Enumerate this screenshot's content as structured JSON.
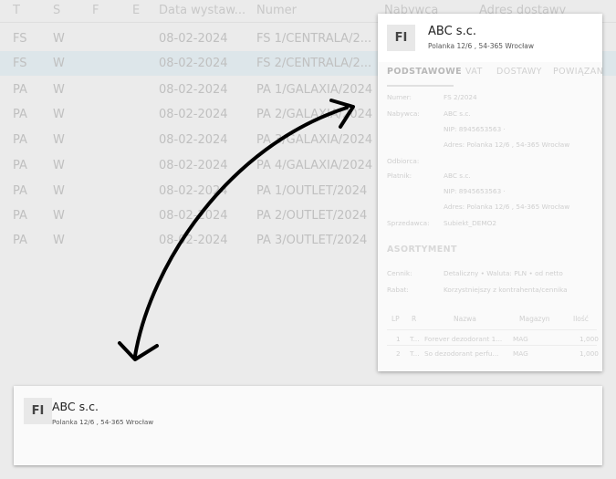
{
  "table": {
    "headers": [
      "T",
      "S",
      "F",
      "E",
      "Data wystaw...",
      "Numer",
      "Nabywca",
      "Adres dostawy"
    ],
    "rows": [
      {
        "t": "FS",
        "s": "W",
        "date": "08-02-2024",
        "num": "FS 1/CENTRALA/2..."
      },
      {
        "t": "FS",
        "s": "W",
        "date": "08-02-2024",
        "num": "FS 2/CENTRALA/2..."
      },
      {
        "t": "PA",
        "s": "W",
        "date": "08-02-2024",
        "num": "PA 1/GALAXIA/2024"
      },
      {
        "t": "PA",
        "s": "W",
        "date": "08-02-2024",
        "num": "PA 2/GALAXIA/2024"
      },
      {
        "t": "PA",
        "s": "W",
        "date": "08-02-2024",
        "num": "PA 3/GALAXIA/2024"
      },
      {
        "t": "PA",
        "s": "W",
        "date": "08-02-2024",
        "num": "PA 4/GALAXIA/2024"
      },
      {
        "t": "PA",
        "s": "W",
        "date": "08-02-2024",
        "num": "PA 1/OUTLET/2024"
      },
      {
        "t": "PA",
        "s": "W",
        "date": "08-02-2024",
        "num": "PA 2/OUTLET/2024"
      },
      {
        "t": "PA",
        "s": "W",
        "date": "08-02-2024",
        "num": "PA 3/OUTLET/2024"
      }
    ]
  },
  "popup": {
    "badge": "FI",
    "name": "ABC s.c.",
    "address": "Polanka 12/6 , 54-365 Wrocław",
    "tabs": [
      "PODSTAWOWE",
      "VAT",
      "DOSTAWY",
      "POWIĄZANE"
    ],
    "fields": {
      "numer_label": "Numer:",
      "numer_value": "FS 2/2024",
      "nabywca_label": "Nabywca:",
      "nabywca_value": "ABC s.c.",
      "nabywca_nip": "NIP: 8945653563  ·",
      "nabywca_adres": "Adres: Polanka  12/6 , 54-365 Wrocław",
      "odbiorca_label": "Odbiorca:",
      "platnik_label": "Płatnik:",
      "platnik_value": "ABC s.c.",
      "platnik_nip": "NIP: 8945653563  ·",
      "platnik_adres": "Adres: Polanka  12/6 , 54-365 Wrocław",
      "sprzedawca_label": "Sprzedawca:",
      "sprzedawca_value": "Subiekt_DEMO2"
    },
    "asortyment": {
      "title": "ASORTYMENT",
      "cennik_label": "Cennik:",
      "cennik_value": "Detaliczny • Waluta: PLN • od netto",
      "rabat_label": "Rabat:",
      "rabat_value": "Korzystniejszy z kontrahenta/cennika",
      "headers": [
        "LP",
        "R",
        "Nazwa",
        "Magazyn",
        "Ilość"
      ],
      "rows": [
        {
          "lp": "1",
          "r": "T...",
          "name": "Forever dezodorant 1...",
          "mag": "MAG",
          "qty": "1,000"
        },
        {
          "lp": "2",
          "r": "T...",
          "name": "So dezodorant perfu...",
          "mag": "MAG",
          "qty": "1,000"
        }
      ]
    }
  },
  "card": {
    "badge": "FI",
    "name": "ABC s.c.",
    "address": "Polanka  12/6 , 54-365 Wrocław"
  }
}
